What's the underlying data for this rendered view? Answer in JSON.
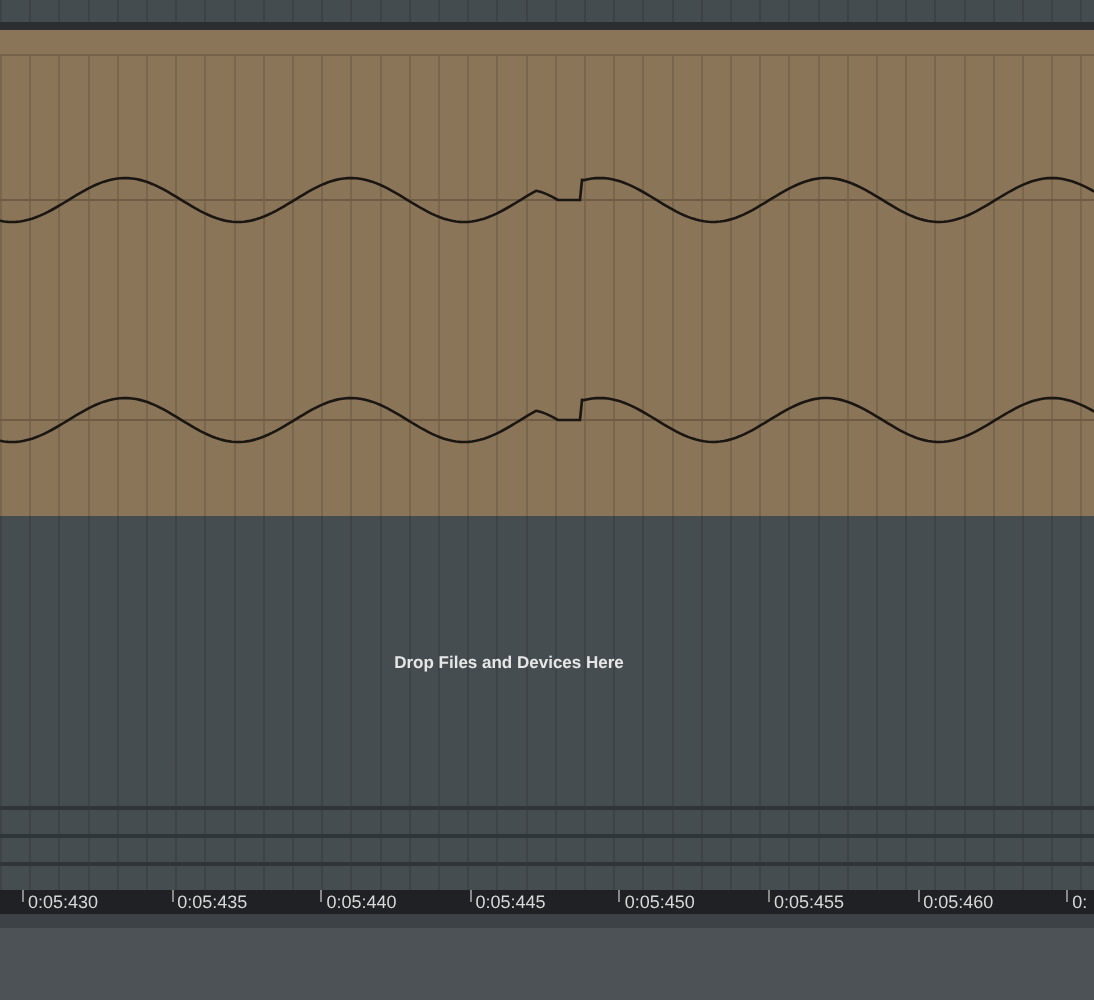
{
  "drop_zone": {
    "hint": "Drop Files and Devices Here"
  },
  "ruler": {
    "labels": [
      "0:05:430",
      "0:05:435",
      "0:05:440",
      "0:05:445",
      "0:05:450",
      "0:05:455",
      "0:05:460",
      "0:"
    ]
  }
}
